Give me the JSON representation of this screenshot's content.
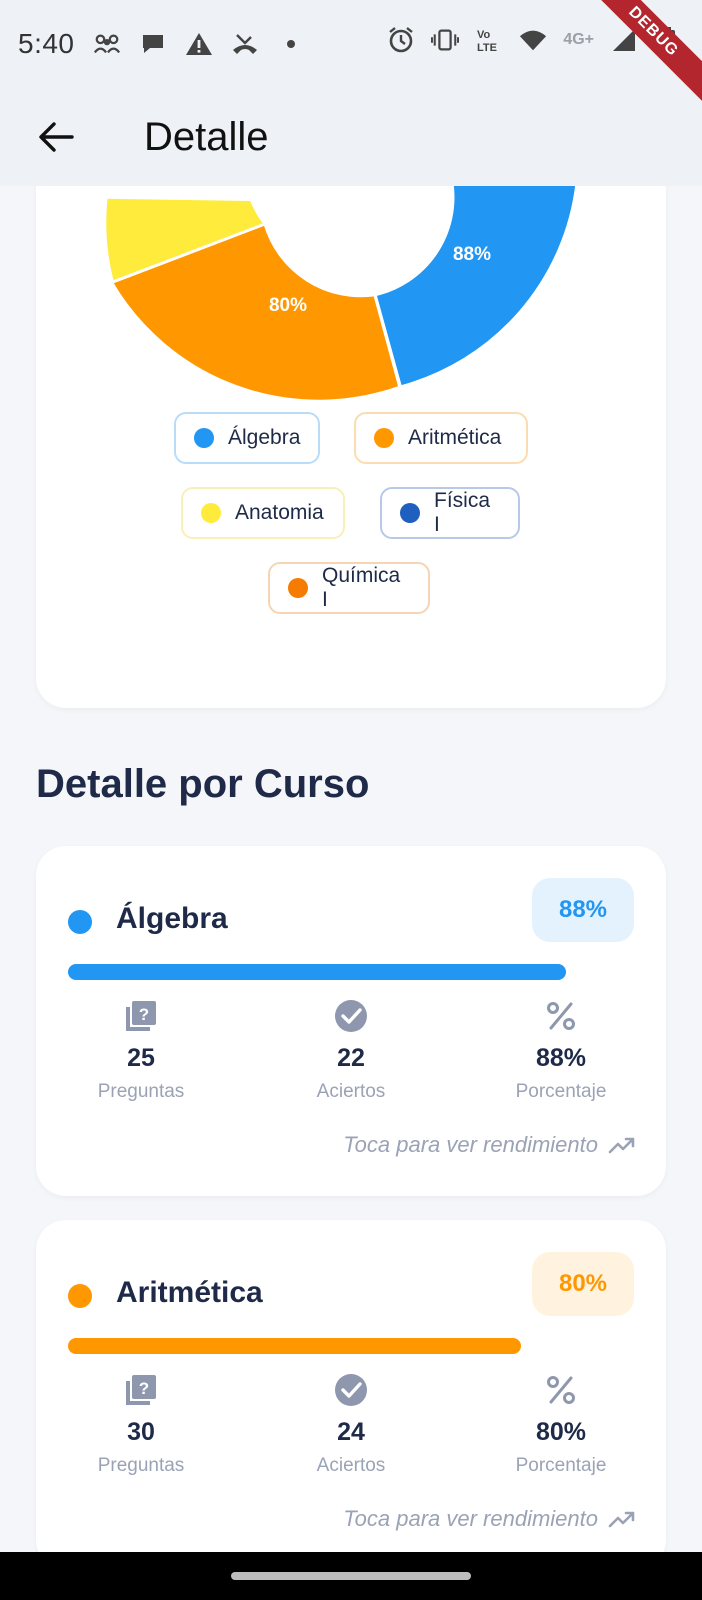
{
  "status": {
    "time": "5:40",
    "network": "4G+",
    "debug": "DEBUG"
  },
  "app_bar": {
    "title": "Detalle"
  },
  "chart_data": {
    "type": "pie",
    "variant": "donut",
    "categories": [
      "Álgebra",
      "Aritmética",
      "Anatomia",
      "Física I",
      "Química I"
    ],
    "visible_labels": {
      "Álgebra": "88%",
      "Aritmética": "80%"
    },
    "colors": [
      "#2196f3",
      "#ff9800",
      "#ffeb3b",
      "#1e5fbf",
      "#f57c00"
    ]
  },
  "legend": [
    {
      "label": "Álgebra",
      "color": "#2196f3",
      "border": "#b9dcf8"
    },
    {
      "label": "Aritmética",
      "color": "#ff9800",
      "border": "#fadcb0"
    },
    {
      "label": "Anatomia",
      "color": "#ffeb3b",
      "border": "#f8f0b8"
    },
    {
      "label": "Física I",
      "color": "#1e5fbf",
      "border": "#b7c9e6"
    },
    {
      "label": "Química I",
      "color": "#f57c00",
      "border": "#f7d4b3"
    }
  ],
  "section_title": "Detalle por Curso",
  "courses": [
    {
      "name": "Álgebra",
      "color": "#2196f3",
      "badge_bg": "#e3f2fd",
      "percent_label": "88%",
      "progress": 0.88,
      "questions": "25",
      "questions_label": "Preguntas",
      "correct": "22",
      "correct_label": "Aciertos",
      "percentage": "88%",
      "percentage_label": "Porcentaje",
      "hint": "Toca para ver rendimiento"
    },
    {
      "name": "Aritmética",
      "color": "#ff9800",
      "badge_bg": "#fff3e0",
      "percent_label": "80%",
      "progress": 0.8,
      "questions": "30",
      "questions_label": "Preguntas",
      "correct": "24",
      "correct_label": "Aciertos",
      "percentage": "80%",
      "percentage_label": "Porcentaje",
      "hint": "Toca para ver rendimiento"
    }
  ]
}
